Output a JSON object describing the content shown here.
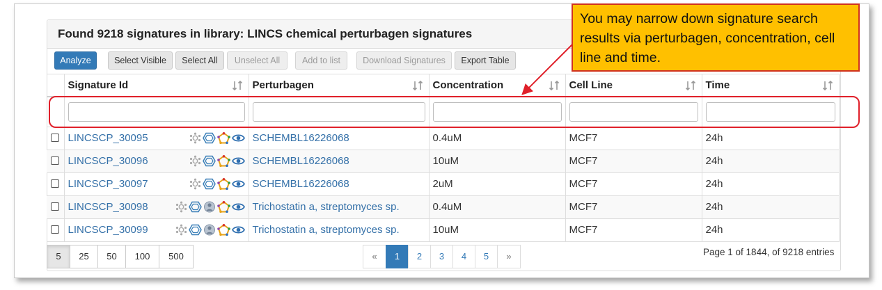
{
  "panel": {
    "title": "Found 9218 signatures in library: LINCS chemical perturbagen signatures"
  },
  "toolbar": {
    "analyze": "Analyze",
    "select_visible": "Select Visible",
    "select_all": "Select All",
    "unselect_all": "Unselect All",
    "add_to_list": "Add to list",
    "download": "Download Signatures",
    "export": "Export Table"
  },
  "columns": {
    "signature_id": "Signature Id",
    "perturbagen": "Perturbagen",
    "concentration": "Concentration",
    "cell_line": "Cell Line",
    "time": "Time"
  },
  "rows": [
    {
      "id": "LINCSCP_30095",
      "perturbagen": "SCHEMBL16226068",
      "concentration": "0.4uM",
      "cell_line": "MCF7",
      "time": "24h"
    },
    {
      "id": "LINCSCP_30096",
      "perturbagen": "SCHEMBL16226068",
      "concentration": "10uM",
      "cell_line": "MCF7",
      "time": "24h"
    },
    {
      "id": "LINCSCP_30097",
      "perturbagen": "SCHEMBL16226068",
      "concentration": "2uM",
      "cell_line": "MCF7",
      "time": "24h"
    },
    {
      "id": "LINCSCP_30098",
      "perturbagen": "Trichostatin a, streptomyces sp.",
      "concentration": "0.4uM",
      "cell_line": "MCF7",
      "time": "24h"
    },
    {
      "id": "LINCSCP_30099",
      "perturbagen": "Trichostatin a, streptomyces sp.",
      "concentration": "10uM",
      "cell_line": "MCF7",
      "time": "24h"
    }
  ],
  "page_sizes": [
    "5",
    "25",
    "50",
    "100",
    "500"
  ],
  "selected_page_size": "5",
  "pager": {
    "prev": "«",
    "pages": [
      "1",
      "2",
      "3",
      "4",
      "5"
    ],
    "next": "»",
    "current": "1"
  },
  "page_info": "Page 1 of 1844, of 9218 entries",
  "callout": "You may narrow down signature search results via perturbagen, concentration, cell line and time.",
  "colors": {
    "primary": "#337ab7",
    "link": "#3470a8",
    "callout_bg": "#ffc000",
    "highlight": "#e0202a"
  }
}
